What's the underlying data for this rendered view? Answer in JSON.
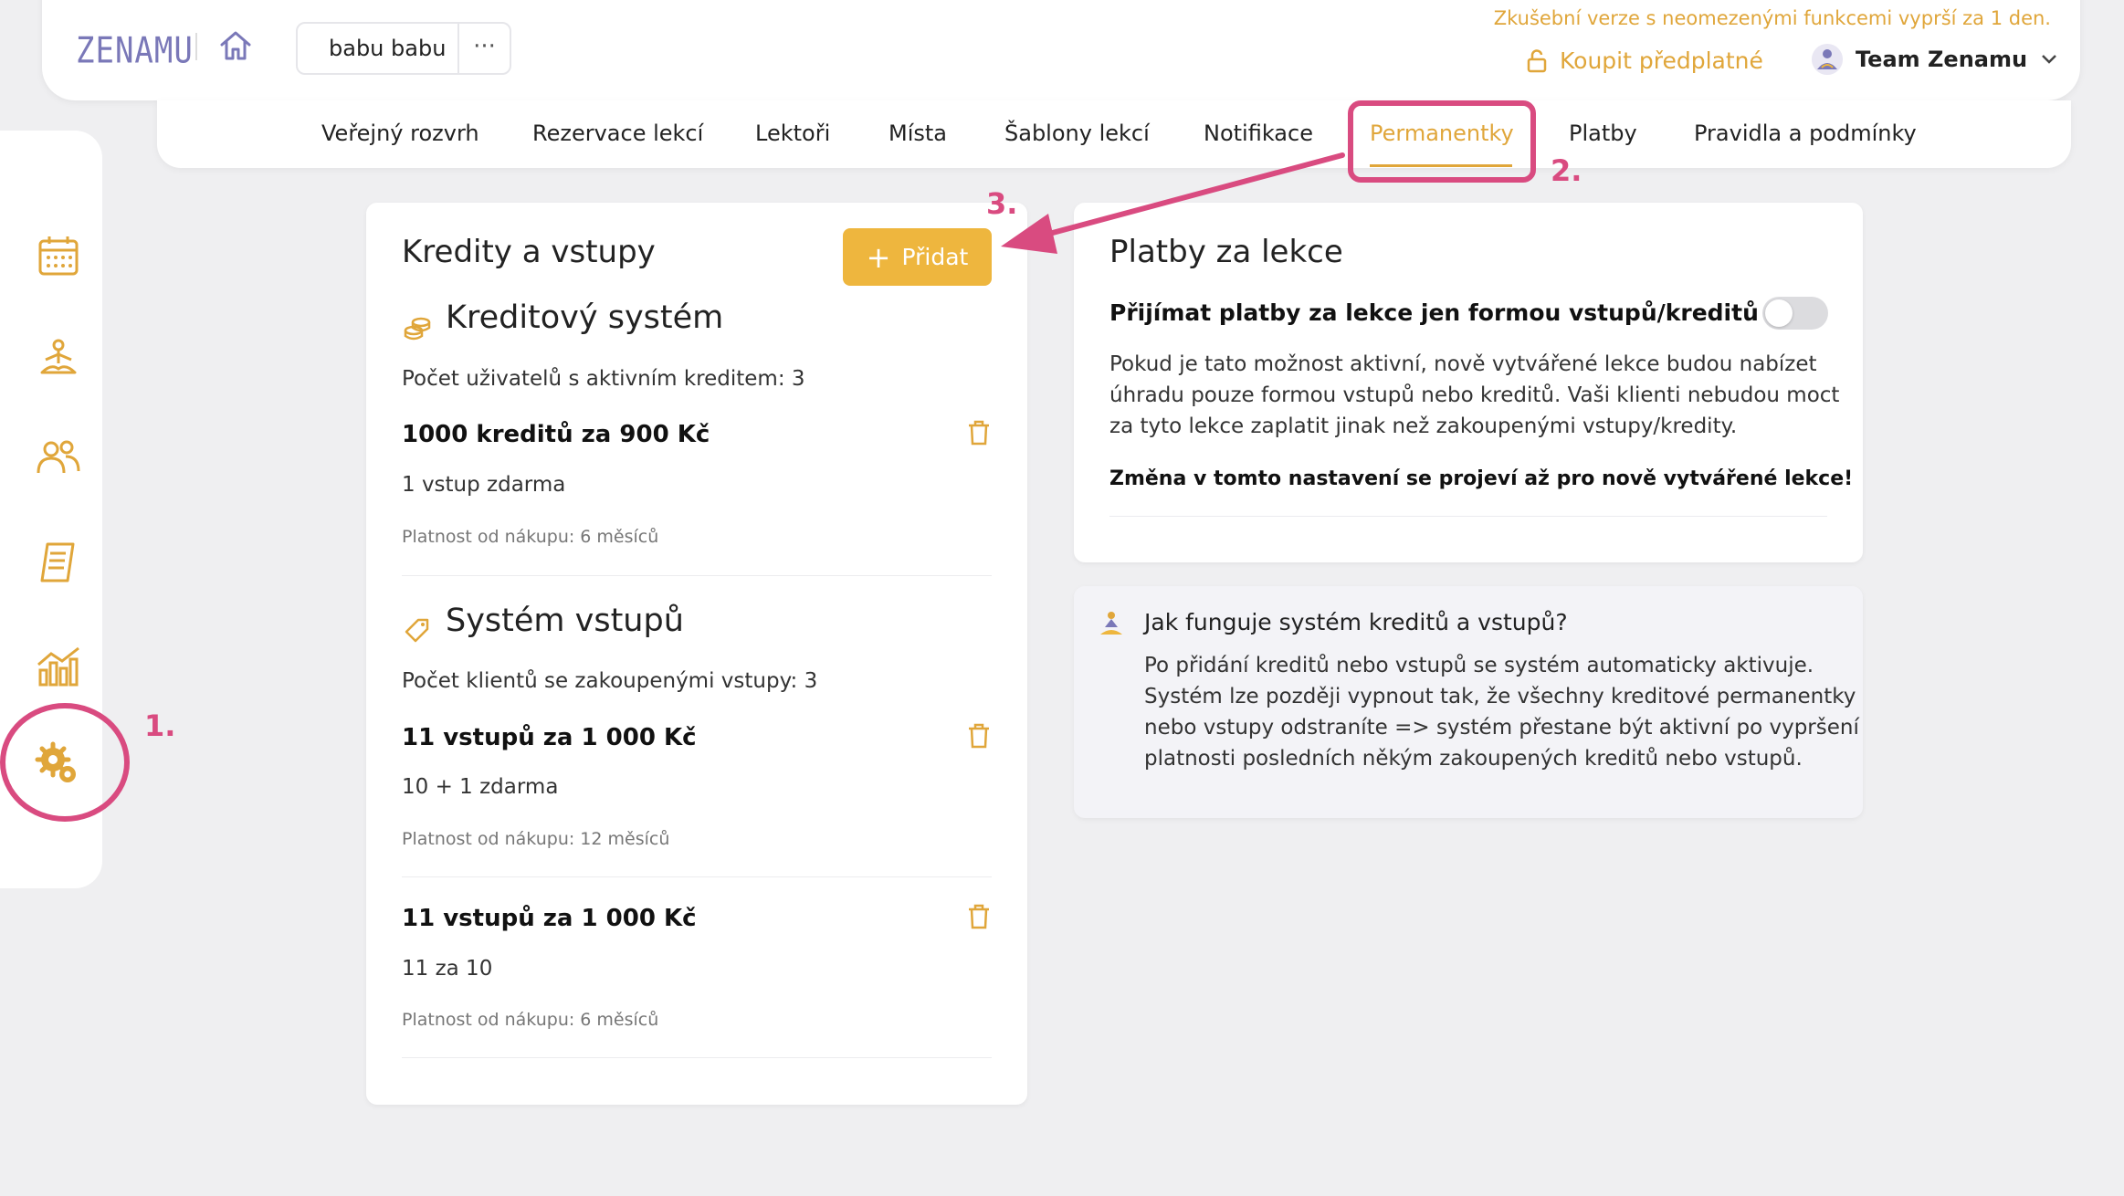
{
  "header": {
    "logo_text": "ZENAMU",
    "studio_name": "babu babu",
    "studio_more": "···",
    "trial_note": "Zkušební verze s neomezenými funkcemi vyprší za 1 den.",
    "buy_label": "Koupit předplatné",
    "team_name": "Team Zenamu"
  },
  "tabs": [
    {
      "label": "Veřejný rozvrh"
    },
    {
      "label": "Rezervace lekcí"
    },
    {
      "label": "Lektoři"
    },
    {
      "label": "Místa"
    },
    {
      "label": "Šablony lekcí"
    },
    {
      "label": "Notifikace"
    },
    {
      "label": "Permanentky",
      "active": true
    },
    {
      "label": "Platby"
    },
    {
      "label": "Pravidla a podmínky"
    }
  ],
  "sidebar": {
    "items": [
      {
        "icon": "calendar-icon"
      },
      {
        "icon": "meditation-icon"
      },
      {
        "icon": "users-icon"
      },
      {
        "icon": "document-icon"
      },
      {
        "icon": "chart-icon"
      },
      {
        "icon": "settings-icon",
        "active": true
      }
    ]
  },
  "credits_card": {
    "title": "Kredity a vstupy",
    "add_label": "Přidat",
    "credit_system": {
      "title": "Kreditový systém",
      "summary": "Počet uživatelů s aktivním kreditem: 3",
      "items": [
        {
          "name": "1000 kreditů za  900 Kč",
          "note": "1 vstup zdarma",
          "validity": "Platnost od nákupu: 6 měsíců"
        }
      ]
    },
    "entry_system": {
      "title": "Systém vstupů",
      "summary": "Počet klientů se zakoupenými vstupy: 3",
      "items": [
        {
          "name": "11 vstupů za  1 000 Kč",
          "note": "10 + 1 zdarma",
          "validity": "Platnost od nákupu: 12 měsíců"
        },
        {
          "name": "11 vstupů za  1 000 Kč",
          "note": "11 za 10",
          "validity": "Platnost od nákupu: 6 měsíců"
        }
      ]
    }
  },
  "payments_card": {
    "title": "Platby za lekce",
    "toggle_label": "Přijímat platby za lekce jen formou vstupů/kreditů",
    "toggle_on": false,
    "description_1": "Pokud je tato možnost aktivní, nově vytvářené lekce budou nabízet",
    "description_2": "úhradu pouze formou vstupů nebo kreditů. Vaši klienti nebudou moct",
    "description_3": "za tyto lekce zaplatit jinak než zakoupenými vstupy/kredity.",
    "warning": "Změna v tomto nastavení se projeví až pro nově vytvářené lekce!"
  },
  "info_card": {
    "title": "Jak funguje systém kreditů a vstupů?",
    "line_1": "Po přidání kreditů nebo vstupů se systém automaticky aktivuje.",
    "line_2": "Systém lze později vypnout tak, že všechny kreditové permanentky",
    "line_3": "nebo vstupy odstraníte => systém přestane být aktivní po vypršení",
    "line_4": "platnosti posledních někým zakoupených kreditů nebo vstupů."
  },
  "annotations": {
    "step_1": "1.",
    "step_2": "2.",
    "step_3": "3."
  },
  "colors": {
    "accent": "#e0a63a",
    "button": "#eeb63e",
    "annotation": "#d94b80",
    "logo": "#7a78b8",
    "background": "#efeff1"
  }
}
